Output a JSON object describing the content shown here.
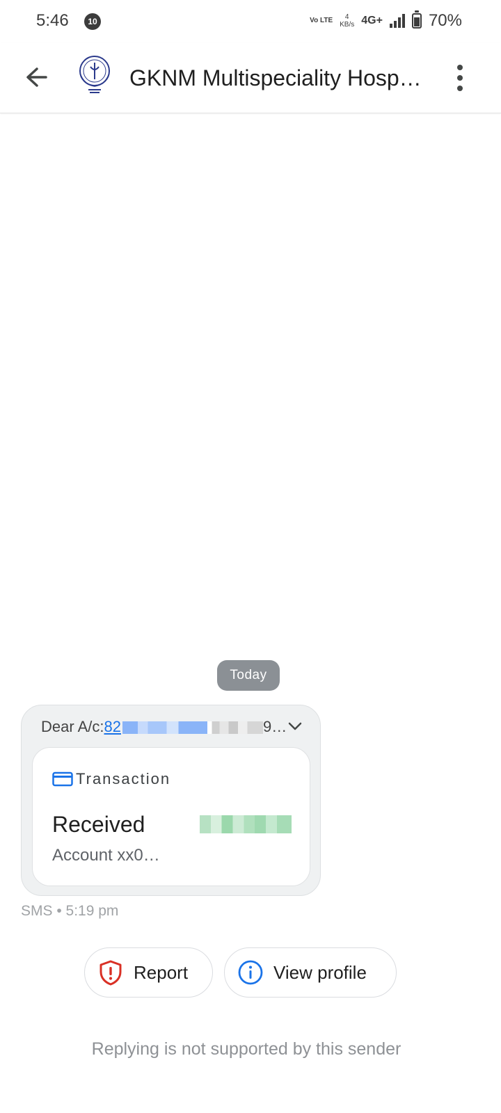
{
  "status_bar": {
    "time": "5:46",
    "notification_count": "10",
    "volte": "Vo LTE",
    "speed_value": "4",
    "speed_unit": "KB/s",
    "network": "4G+",
    "battery": "70%",
    "battery_level": 0.7
  },
  "header": {
    "title": "GKNM Multispeciality Hosp…",
    "back_icon": "arrow-back-icon",
    "menu_icon": "more-vert-icon",
    "logo": "hospital-logo"
  },
  "conversation": {
    "day_label": "Today",
    "message": {
      "preview_prefix": "Dear A/c:",
      "preview_link": "82",
      "preview_suffix": "9…",
      "card": {
        "category": "Transaction",
        "title": "Received",
        "account": "Account xx0…"
      },
      "meta": "SMS • 5:19 pm"
    }
  },
  "actions": {
    "report_label": "Report",
    "view_profile_label": "View profile"
  },
  "footer": {
    "note": "Replying is not supported by this sender"
  },
  "colors": {
    "accent": "#1a73e8",
    "report_red": "#d93025",
    "chip_bg": "#8b9095",
    "bubble_bg": "#eff1f2"
  }
}
